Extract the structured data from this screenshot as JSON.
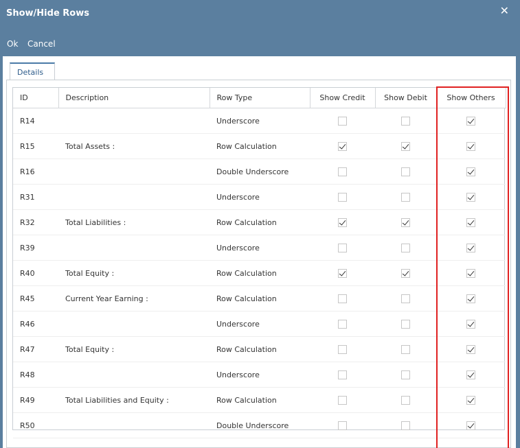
{
  "dialog": {
    "title": "Show/Hide Rows",
    "close_label": "✕"
  },
  "toolbar": {
    "ok_label": "Ok",
    "cancel_label": "Cancel"
  },
  "tabs": [
    {
      "label": "Details"
    }
  ],
  "table": {
    "columns": [
      "ID",
      "Description",
      "Row Type",
      "Show Credit",
      "Show Debit",
      "Show Others"
    ],
    "rows": [
      {
        "id": "R14",
        "description": "",
        "row_type": "Underscore",
        "show_credit": false,
        "show_debit": false,
        "show_others": true
      },
      {
        "id": "R15",
        "description": "Total Assets :",
        "row_type": "Row Calculation",
        "show_credit": true,
        "show_debit": true,
        "show_others": true
      },
      {
        "id": "R16",
        "description": "",
        "row_type": "Double Underscore",
        "show_credit": false,
        "show_debit": false,
        "show_others": true
      },
      {
        "id": "R31",
        "description": "",
        "row_type": "Underscore",
        "show_credit": false,
        "show_debit": false,
        "show_others": true
      },
      {
        "id": "R32",
        "description": "Total Liabilities :",
        "row_type": "Row Calculation",
        "show_credit": true,
        "show_debit": true,
        "show_others": true
      },
      {
        "id": "R39",
        "description": "",
        "row_type": "Underscore",
        "show_credit": false,
        "show_debit": false,
        "show_others": true
      },
      {
        "id": "R40",
        "description": "Total Equity :",
        "row_type": "Row Calculation",
        "show_credit": true,
        "show_debit": true,
        "show_others": true
      },
      {
        "id": "R45",
        "description": "Current Year Earning :",
        "row_type": "Row Calculation",
        "show_credit": false,
        "show_debit": false,
        "show_others": true
      },
      {
        "id": "R46",
        "description": "",
        "row_type": "Underscore",
        "show_credit": false,
        "show_debit": false,
        "show_others": true
      },
      {
        "id": "R47",
        "description": "Total Equity :",
        "row_type": "Row Calculation",
        "show_credit": false,
        "show_debit": false,
        "show_others": true
      },
      {
        "id": "R48",
        "description": "",
        "row_type": "Underscore",
        "show_credit": false,
        "show_debit": false,
        "show_others": true
      },
      {
        "id": "R49",
        "description": "Total Liabilities and Equity :",
        "row_type": "Row Calculation",
        "show_credit": false,
        "show_debit": false,
        "show_others": true
      },
      {
        "id": "R50",
        "description": "",
        "row_type": "Double Underscore",
        "show_credit": false,
        "show_debit": false,
        "show_others": true
      }
    ]
  },
  "colors": {
    "header_bg": "#5b7f9f",
    "highlight": "#e02020",
    "tab_text": "#2c5b8a"
  }
}
